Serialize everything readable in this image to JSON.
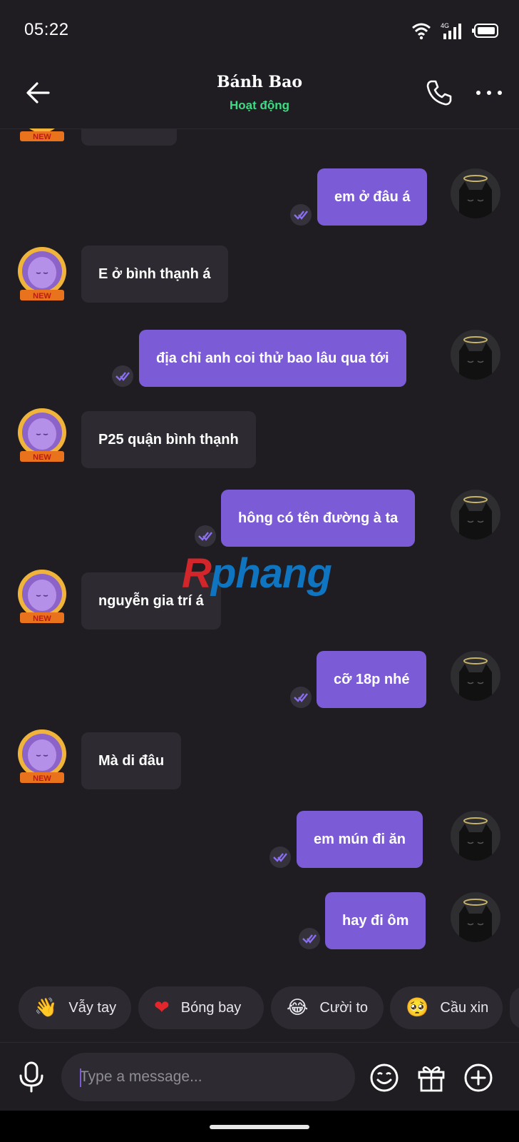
{
  "status_bar": {
    "time": "05:22",
    "network": "4G"
  },
  "header": {
    "title": "Bánh Bao",
    "subtitle": "Hoạt động"
  },
  "badge_text": "NEW",
  "messages": [
    {
      "dir": "out",
      "text": "em ở đâu á"
    },
    {
      "dir": "in",
      "text": "E ở bình thạnh á"
    },
    {
      "dir": "out",
      "text": "địa chỉ anh coi thử bao lâu qua tới"
    },
    {
      "dir": "in",
      "text": "P25 quận bình thạnh"
    },
    {
      "dir": "out",
      "text": "hông có tên đường à ta"
    },
    {
      "dir": "in",
      "text": "nguyễn gia trí á"
    },
    {
      "dir": "out",
      "text": "cỡ 18p nhé"
    },
    {
      "dir": "in",
      "text": "Mà di đâu"
    },
    {
      "dir": "out",
      "text": "em mún đi ăn"
    },
    {
      "dir": "out",
      "text": "hay đi ôm"
    }
  ],
  "watermark": {
    "first": "R",
    "rest": "phang"
  },
  "quick_replies": [
    {
      "emoji": "👋",
      "label": "Vẫy tay"
    },
    {
      "emoji": "❤",
      "label": "Bóng bay"
    },
    {
      "emoji": "😂",
      "label": "Cười to"
    },
    {
      "emoji": "🥺",
      "label": "Cầu xin"
    }
  ],
  "input": {
    "placeholder": "Type a message..."
  },
  "colors": {
    "outgoing_bubble": "#7b5cd6",
    "incoming_bubble": "#2d2b31",
    "online": "#3ddc84"
  }
}
